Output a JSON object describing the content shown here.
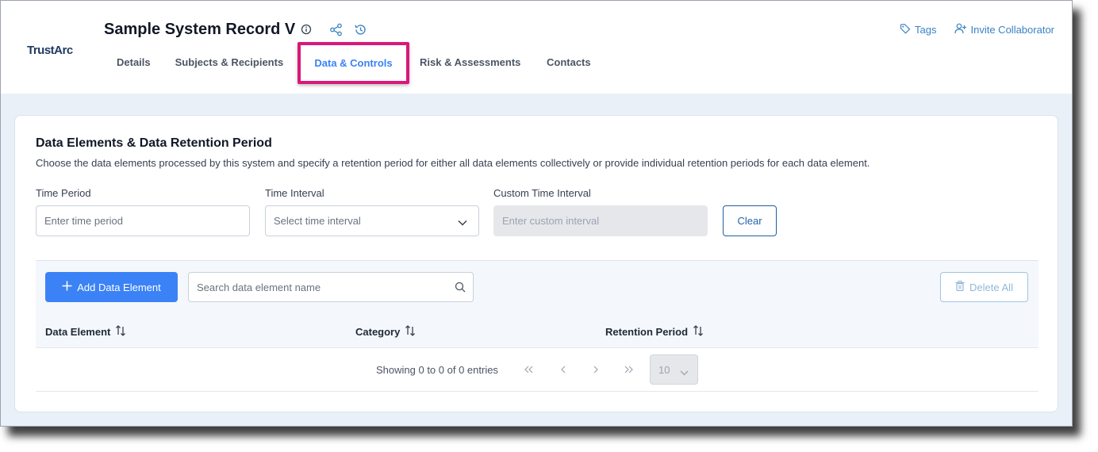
{
  "app": {
    "logo_text": "TrustArc",
    "record_title": "Sample System Record V"
  },
  "header_links": {
    "tags": "Tags",
    "invite": "Invite Collaborator"
  },
  "tabs": [
    {
      "label": "Details"
    },
    {
      "label": "Subjects & Recipients"
    },
    {
      "label": "Data & Controls"
    },
    {
      "label": "Risk & Assessments"
    },
    {
      "label": "Contacts"
    }
  ],
  "section": {
    "title": "Data Elements & Data Retention Period",
    "description": "Choose the data elements processed by this system and specify a retention period for either all data elements collectively or provide individual retention periods for each data element."
  },
  "retention_form": {
    "time_period_label": "Time Period",
    "time_period_placeholder": "Enter time period",
    "time_interval_label": "Time Interval",
    "time_interval_placeholder": "Select time interval",
    "custom_interval_label": "Custom Time Interval",
    "custom_interval_placeholder": "Enter custom interval",
    "clear_label": "Clear"
  },
  "table": {
    "add_label": "Add Data Element",
    "search_placeholder": "Search data element name",
    "delete_all_label": "Delete All",
    "columns": [
      "Data Element",
      "Category",
      "Retention Period"
    ],
    "pager_text": "Showing 0 to 0 of 0 entries",
    "page_size": "10"
  },
  "colors": {
    "accent": "#3b82f6",
    "highlight_box": "#d9187a",
    "page_bg": "#e9f0f8"
  }
}
